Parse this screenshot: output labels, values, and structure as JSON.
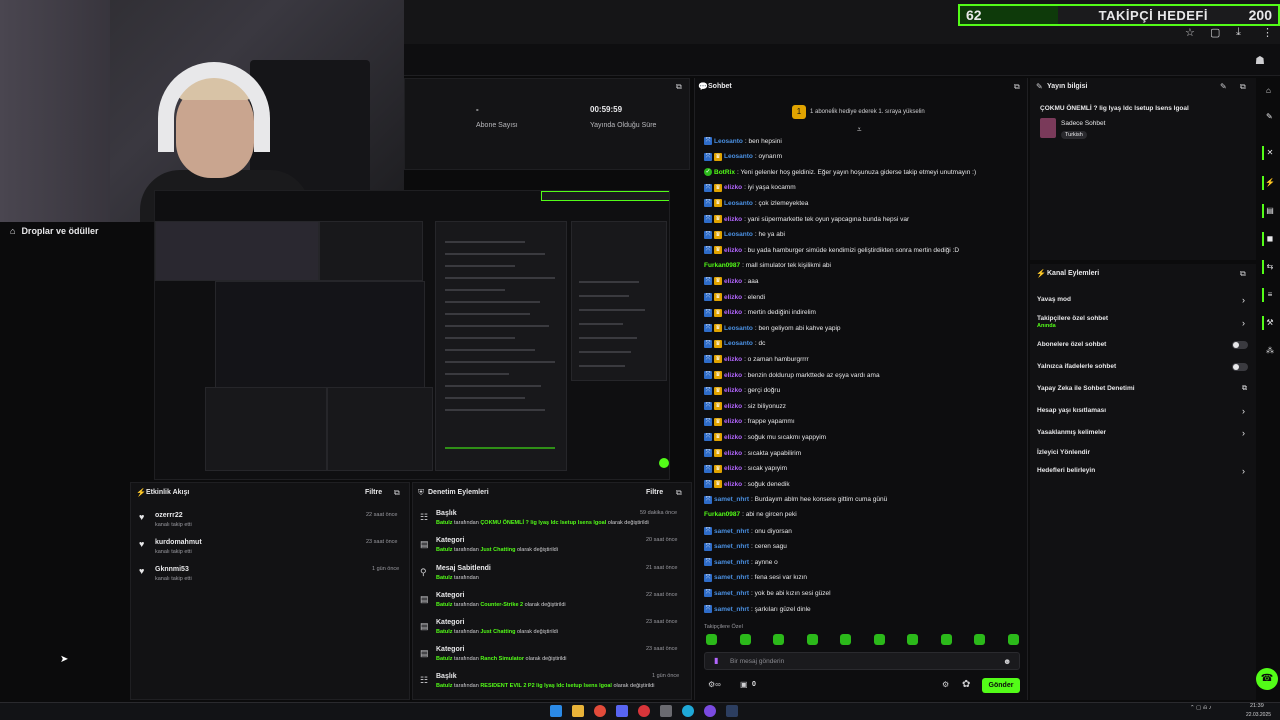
{
  "goal": {
    "current": "62",
    "label": "TAKİPÇİ HEDEFİ",
    "target": "200"
  },
  "drops_label": "Droplar ve ödüller",
  "stats": {
    "dash": "-",
    "sub_label": "Abone Sayısı",
    "time_value": "00:59:59",
    "time_label": "Yayında Olduğu Süre"
  },
  "activity": {
    "title": "Etkinlik Akışı",
    "filter": "Filtre",
    "items": [
      {
        "name": "ozerrr22",
        "sub": "kanalı takip etti",
        "time": "22 saat önce"
      },
      {
        "name": "kurdomahmut",
        "sub": "kanalı takip etti",
        "time": "23 saat önce"
      },
      {
        "name": "Gknnmi53",
        "sub": "kanalı takip etti",
        "time": "1 gün önce"
      }
    ]
  },
  "moderation": {
    "title": "Denetim Eylemleri",
    "filter": "Filtre",
    "items": [
      {
        "title": "Başlık",
        "user": "Batulz",
        "mid": " tarafından ",
        "value": "ÇOKMU ÖNEMLİ ? lig lyaş ldc lsetup lsens lgoal",
        "tail": " olarak değiştirildi",
        "time": "59 dakika önce"
      },
      {
        "title": "Kategori",
        "user": "Batulz",
        "mid": " tarafından ",
        "value": "Just Chatting",
        "tail": " olarak değiştirildi",
        "time": "20 saat önce"
      },
      {
        "title": "Mesaj Sabitlendi",
        "user": "Batulz",
        "mid": " tarafından",
        "value": "",
        "tail": "",
        "time": "21 saat önce"
      },
      {
        "title": "Kategori",
        "user": "Batulz",
        "mid": " tarafından ",
        "value": "Counter-Strike 2",
        "tail": " olarak değiştirildi",
        "time": "22 saat önce"
      },
      {
        "title": "Kategori",
        "user": "Batulz",
        "mid": " tarafından ",
        "value": "Just Chatting",
        "tail": " olarak değiştirildi",
        "time": "23 saat önce"
      },
      {
        "title": "Kategori",
        "user": "Batulz",
        "mid": " tarafından ",
        "value": "Ranch Simulator",
        "tail": " olarak değiştirildi",
        "time": "23 saat önce"
      },
      {
        "title": "Başlık",
        "user": "Batulz",
        "mid": " tarafından ",
        "value": "RESIDENT EVIL 2 P2 lig lyaş ldc lsetup lsens lgoal",
        "tail": " olarak değiştirildi",
        "time": "1 gün önce"
      }
    ]
  },
  "chat": {
    "title": "Sohbet",
    "pinned": "1 aboneli̇k hediye ederek 1. sıraya yükselin",
    "messages": [
      {
        "user": "Leosanto",
        "text": ": ben hepsini",
        "color": "#4a90e2",
        "badges": [
          "blue"
        ]
      },
      {
        "user": "Leosanto",
        "text": ": oynarım",
        "color": "#4a90e2",
        "badges": [
          "blue",
          "gold"
        ]
      },
      {
        "user": "BotRix",
        "text": ": Yeni gelenler hoş geldiniz. Eğer yayın hoşunuza giderse takip etmeyi unutmayın :)",
        "color": "#53fc18",
        "badges": [
          "bot"
        ]
      },
      {
        "user": "elizko",
        "text": ": iyi yaşa kocamm",
        "color": "#b366ff",
        "badges": [
          "blue",
          "gold"
        ]
      },
      {
        "user": "Leosanto",
        "text": ": çok izlemeyektea",
        "color": "#4a90e2",
        "badges": [
          "blue",
          "gold"
        ]
      },
      {
        "user": "elizko",
        "text": ": yani süpermarkette tek oyun yapcagına bunda hepsi var",
        "color": "#b366ff",
        "badges": [
          "blue",
          "gold"
        ]
      },
      {
        "user": "Leosanto",
        "text": ": he ya abi",
        "color": "#4a90e2",
        "badges": [
          "blue",
          "gold"
        ]
      },
      {
        "user": "elizko",
        "text": ": bu yada hamburger simüde kendimizi geliştirdikten sonra mertin dediği :D",
        "color": "#b366ff",
        "badges": [
          "blue",
          "gold"
        ]
      },
      {
        "user": "Furkan0987",
        "text": ": mall simulator tek kişilikmi abi",
        "color": "#53fc18",
        "badges": []
      },
      {
        "user": "elizko",
        "text": ": aaa",
        "color": "#b366ff",
        "badges": [
          "blue",
          "gold"
        ]
      },
      {
        "user": "elizko",
        "text": ": elendi",
        "color": "#b366ff",
        "badges": [
          "blue",
          "gold"
        ]
      },
      {
        "user": "elizko",
        "text": ": mertin dediğini indirelim",
        "color": "#b366ff",
        "badges": [
          "blue",
          "gold"
        ]
      },
      {
        "user": "Leosanto",
        "text": ": ben geliyom abi kahve yapip",
        "color": "#4a90e2",
        "badges": [
          "blue",
          "gold"
        ]
      },
      {
        "user": "Leosanto",
        "text": ": dc",
        "color": "#4a90e2",
        "badges": [
          "blue",
          "gold"
        ]
      },
      {
        "user": "elizko",
        "text": ": o zaman hamburgrrrr",
        "color": "#b366ff",
        "badges": [
          "blue",
          "gold"
        ]
      },
      {
        "user": "elizko",
        "text": ": benzin doldurup markttede az eşya vardı ama",
        "color": "#b366ff",
        "badges": [
          "blue",
          "gold"
        ]
      },
      {
        "user": "elizko",
        "text": ": gerçi doğru",
        "color": "#b366ff",
        "badges": [
          "blue",
          "gold"
        ]
      },
      {
        "user": "elizko",
        "text": ": siz biliyonuzz",
        "color": "#b366ff",
        "badges": [
          "blue",
          "gold"
        ]
      },
      {
        "user": "elizko",
        "text": ": frappe yapammı",
        "color": "#b366ff",
        "badges": [
          "blue",
          "gold"
        ]
      },
      {
        "user": "elizko",
        "text": ": soğuk mu sıcakmı yappyim",
        "color": "#b366ff",
        "badges": [
          "blue",
          "gold"
        ]
      },
      {
        "user": "elizko",
        "text": ": sıcakta yapabilirim",
        "color": "#b366ff",
        "badges": [
          "blue",
          "gold"
        ]
      },
      {
        "user": "elizko",
        "text": ": sıcak yapıyim",
        "color": "#b366ff",
        "badges": [
          "blue",
          "gold"
        ]
      },
      {
        "user": "elizko",
        "text": ": soğuk denedik",
        "color": "#b366ff",
        "badges": [
          "blue",
          "gold"
        ]
      },
      {
        "user": "samet_nhrt",
        "text": ": Burdayım ablm hee konsere gittim cuma günü",
        "color": "#4a90e2",
        "badges": [
          "blue"
        ]
      },
      {
        "user": "Furkan0987",
        "text": ": abi ne gircen peki",
        "color": "#53fc18",
        "badges": []
      },
      {
        "user": "samet_nhrt",
        "text": ": onu diyorsan",
        "color": "#4a90e2",
        "badges": [
          "blue"
        ]
      },
      {
        "user": "samet_nhrt",
        "text": ": ceren sagu",
        "color": "#4a90e2",
        "badges": [
          "blue"
        ]
      },
      {
        "user": "samet_nhrt",
        "text": ": aynne o",
        "color": "#4a90e2",
        "badges": [
          "blue"
        ]
      },
      {
        "user": "samet_nhrt",
        "text": ": fena sesi var kızın",
        "color": "#4a90e2",
        "badges": [
          "blue"
        ]
      },
      {
        "user": "samet_nhrt",
        "text": ": yok be abi kızın sesi güzel",
        "color": "#4a90e2",
        "badges": [
          "blue"
        ]
      },
      {
        "user": "samet_nhrt",
        "text": ": şarkıları güzel dinle",
        "color": "#4a90e2",
        "badges": [
          "blue"
        ]
      }
    ],
    "followers_only": "Takipçilere Özel",
    "input_placeholder": "Bir mesaj gönderin",
    "count": "0",
    "send": "Gönder"
  },
  "stream_info": {
    "title": "Yayın bilgisi",
    "stream_title": "ÇOKMU ÖNEMLİ ? lig lyaş ldc lsetup lsens lgoal",
    "category": "Sadece Sohbet",
    "language": "Turkish"
  },
  "channel_actions": {
    "title": "Kanal Eylemleri",
    "items": [
      {
        "label": "Yavaş mod",
        "control": "chevron"
      },
      {
        "label": "Takipçilere özel sohbet",
        "sub": "Anında",
        "control": "chevron"
      },
      {
        "label": "Abonelere özel sohbet",
        "control": "toggle"
      },
      {
        "label": "Yalnızca ifadelerle sohbet",
        "control": "toggle"
      },
      {
        "label": "Yapay Zeka ile Sohbet Denetimi",
        "control": "external"
      },
      {
        "label": "Hesap yaşı kısıtlaması",
        "control": "chevron"
      },
      {
        "label": "Yasaklanmış kelimeler",
        "control": "chevron"
      },
      {
        "label": "İzleyici Yönlendir",
        "control": "none"
      },
      {
        "label": "Hedefleri belirleyin",
        "control": "chevron"
      }
    ]
  },
  "taskbar": {
    "time": "21:39",
    "date": "22.03.2025"
  }
}
